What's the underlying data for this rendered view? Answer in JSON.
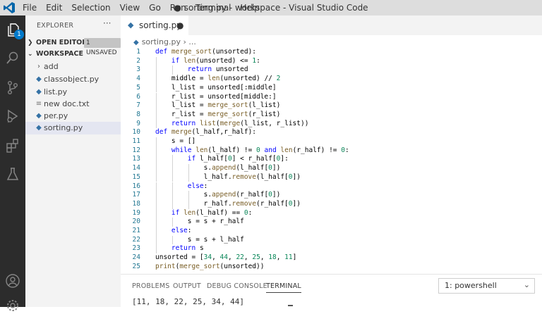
{
  "window": {
    "title": "● sorting.py - workspace - Visual Studio Code"
  },
  "menu": [
    "File",
    "Edit",
    "Selection",
    "View",
    "Go",
    "Run",
    "Terminal",
    "Help"
  ],
  "activity": {
    "explorer_badge": "1"
  },
  "sidebar": {
    "title": "EXPLORER",
    "more": "···",
    "open_editors": {
      "label": "OPEN EDITORS",
      "badge": "1 UNSAVED"
    },
    "workspace": {
      "label": "WORKSPACE"
    },
    "items": [
      {
        "name": "add",
        "kind": "folder"
      },
      {
        "name": "classobject.py",
        "kind": "python"
      },
      {
        "name": "list.py",
        "kind": "python"
      },
      {
        "name": "new doc.txt",
        "kind": "text"
      },
      {
        "name": "per.py",
        "kind": "python"
      },
      {
        "name": "sorting.py",
        "kind": "python",
        "selected": true
      }
    ]
  },
  "tab": {
    "label": "sorting.py",
    "modified": "●"
  },
  "breadcrumb": "sorting.py › ...",
  "code": [
    "def merge_sort(unsorted):",
    "    if len(unsorted) <= 1:",
    "        return unsorted",
    "    middle = len(unsorted) // 2",
    "    l_list = unsorted[:middle]",
    "    r_list = unsorted[middle:]",
    "    l_list = merge_sort(l_list)",
    "    r_list = merge_sort(r_list)",
    "    return list(merge(l_list, r_list))",
    "def merge(l_half,r_half):",
    "    s = []",
    "    while len(l_half) != 0 and len(r_half) != 0:",
    "        if l_half[0] < r_half[0]:",
    "            s.append(l_half[0])",
    "            l_half.remove(l_half[0])",
    "        else:",
    "            s.append(r_half[0])",
    "            r_half.remove(r_half[0])",
    "    if len(l_half) == 0:",
    "        s = s + r_half",
    "    else:",
    "        s = s + l_half",
    "    return s",
    "unsorted = [34, 44, 22, 25, 18, 11]",
    "print(merge_sort(unsorted))"
  ],
  "panel": {
    "tabs": [
      "PROBLEMS",
      "OUTPUT",
      "DEBUG CONSOLE",
      "TERMINAL"
    ],
    "active_tab": "TERMINAL",
    "shell": "1: powershell",
    "output": "[11, 18, 22, 25, 34, 44]"
  },
  "colors": {
    "keyword": "#0000ff",
    "number": "#098658",
    "function": "#795e26",
    "accent": "#007acc"
  }
}
